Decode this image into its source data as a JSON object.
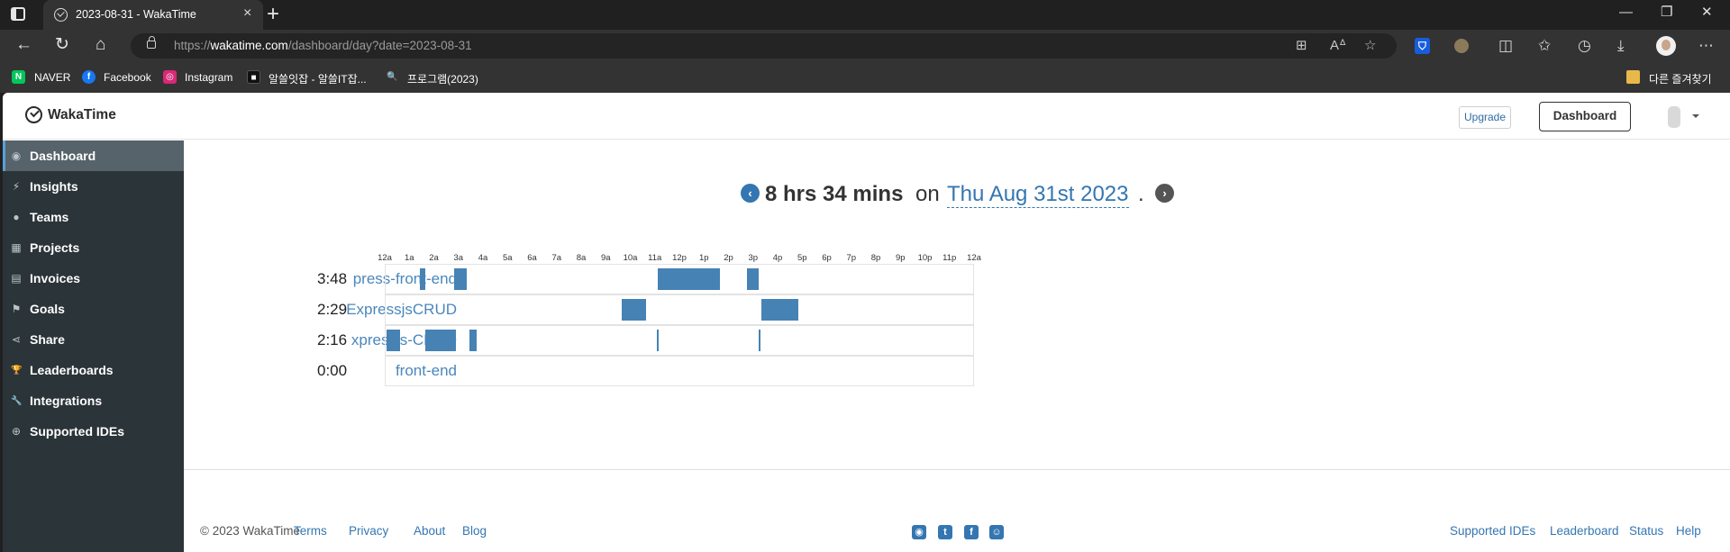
{
  "browser": {
    "tab_title": "2023-08-31 - WakaTime",
    "new_tab_label": "+",
    "close_tab_label": "×",
    "url_prefix": "https://",
    "url_domain": "wakatime.com",
    "url_path": "/dashboard/day?date=2023-08-31",
    "bookmarks": [
      {
        "label": "NAVER",
        "icon": "N",
        "color": "#03c75a"
      },
      {
        "label": "Facebook",
        "icon": "f",
        "color": "#1877f2"
      },
      {
        "label": "Instagram",
        "icon": "◎",
        "color": "#d62976"
      },
      {
        "label": "알쓸잇잡 - 알쓸IT잡...",
        "icon": "■",
        "color": "#111111"
      },
      {
        "label": "프로그램(2023)",
        "icon": "🔍",
        "color": "#333333"
      }
    ],
    "other_bookmarks": "다른 즐겨찾기"
  },
  "app": {
    "logo_text": "WakaTime",
    "upgrade_label": "Upgrade",
    "dashboard_label": "Dashboard"
  },
  "sidebar": {
    "items": [
      {
        "label": "Dashboard",
        "icon": "◉",
        "active": true
      },
      {
        "label": "Insights",
        "icon": "⚡",
        "active": false
      },
      {
        "label": "Teams",
        "icon": "●",
        "active": false
      },
      {
        "label": "Projects",
        "icon": "▦",
        "active": false
      },
      {
        "label": "Invoices",
        "icon": "▤",
        "active": false
      },
      {
        "label": "Goals",
        "icon": "⚑",
        "active": false
      },
      {
        "label": "Share",
        "icon": "⋖",
        "active": false
      },
      {
        "label": "Leaderboards",
        "icon": "🏆",
        "active": false
      },
      {
        "label": "Integrations",
        "icon": "🔧",
        "active": false
      },
      {
        "label": "Supported IDEs",
        "icon": "⊕",
        "active": false
      }
    ]
  },
  "day": {
    "total": "8 hrs 34 mins",
    "on": "on",
    "date": "Thu Aug 31st 2023",
    "dot": "."
  },
  "timeline": {
    "ticks": [
      "12a",
      "1a",
      "2a",
      "3a",
      "4a",
      "5a",
      "6a",
      "7a",
      "8a",
      "9a",
      "10a",
      "11a",
      "12p",
      "1p",
      "2p",
      "3p",
      "4p",
      "5p",
      "6p",
      "7p",
      "8p",
      "9p",
      "10p",
      "11p",
      "12a"
    ],
    "rows": [
      {
        "name": "press-front-end",
        "time": "3:48",
        "segments": [
          [
            1.4,
            1.6
          ],
          [
            2.8,
            3.3
          ],
          [
            11.1,
            13.6
          ],
          [
            14.7,
            15.2
          ]
        ]
      },
      {
        "name": "ExpressjsCRUD",
        "time": "2:29",
        "segments": [
          [
            9.6,
            10.6
          ],
          [
            15.3,
            16.8
          ]
        ]
      },
      {
        "name": "xpressjs-CRUD",
        "time": "2:16",
        "segments": [
          [
            0.05,
            0.6
          ],
          [
            1.6,
            2.85
          ],
          [
            3.4,
            3.7
          ],
          [
            11.05,
            11.12
          ],
          [
            15.2,
            15.27
          ]
        ]
      },
      {
        "name": "front-end",
        "time": "0:00",
        "segments": []
      }
    ]
  },
  "footer": {
    "copyright": "© 2023 WakaTime",
    "links_left": [
      "Terms",
      "Privacy",
      "About",
      "Blog"
    ],
    "links_right": [
      "Supported IDEs",
      "Leaderboard",
      "Status",
      "Help"
    ],
    "social_icons": [
      "github-icon",
      "twitter-icon",
      "facebook-icon",
      "reddit-icon"
    ]
  }
}
